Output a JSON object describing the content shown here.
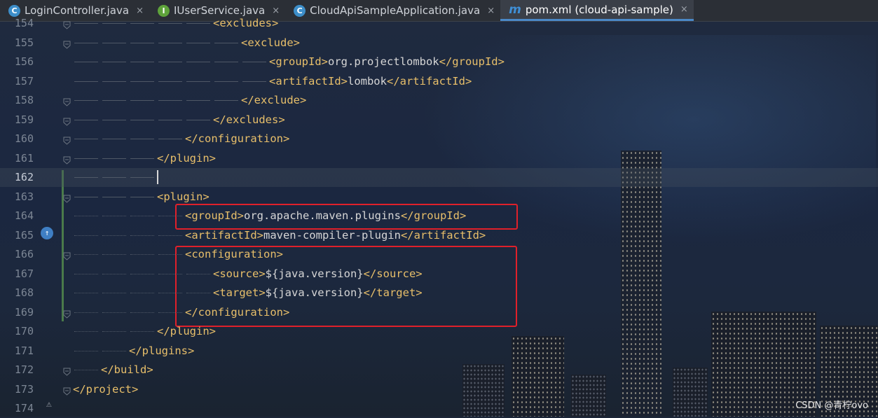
{
  "tabs": [
    {
      "label": "LoginController.java",
      "icon": "class-icon",
      "glyph": "C",
      "active": false
    },
    {
      "label": "IUserService.java",
      "icon": "interface-icon",
      "glyph": "I",
      "active": false
    },
    {
      "label": "CloudApiSampleApplication.java",
      "icon": "application-class-icon",
      "glyph": "C",
      "active": false
    },
    {
      "label": "pom.xml (cloud-api-sample)",
      "icon": "maven-icon",
      "glyph": "m",
      "active": true
    }
  ],
  "tab_close_glyph": "×",
  "lines": [
    {
      "num": "154",
      "indent": 5,
      "parts": [
        {
          "t": "tag",
          "v": "<excludes>"
        }
      ]
    },
    {
      "num": "155",
      "indent": 6,
      "parts": [
        {
          "t": "tag",
          "v": "<exclude>"
        }
      ]
    },
    {
      "num": "156",
      "indent": 7,
      "parts": [
        {
          "t": "tag",
          "v": "<groupId>"
        },
        {
          "t": "txt",
          "v": "org.projectlombok"
        },
        {
          "t": "tag",
          "v": "</groupId>"
        }
      ]
    },
    {
      "num": "157",
      "indent": 7,
      "parts": [
        {
          "t": "tag",
          "v": "<artifactId>"
        },
        {
          "t": "txt",
          "v": "lombok"
        },
        {
          "t": "tag",
          "v": "</artifactId>"
        }
      ]
    },
    {
      "num": "158",
      "indent": 6,
      "parts": [
        {
          "t": "tag",
          "v": "</exclude>"
        }
      ]
    },
    {
      "num": "159",
      "indent": 5,
      "parts": [
        {
          "t": "tag",
          "v": "</excludes>"
        }
      ]
    },
    {
      "num": "160",
      "indent": 4,
      "parts": [
        {
          "t": "tag",
          "v": "</configuration>"
        }
      ]
    },
    {
      "num": "161",
      "indent": 3,
      "parts": [
        {
          "t": "tag",
          "v": "</plugin>"
        }
      ]
    },
    {
      "num": "162",
      "indent": 3,
      "parts": [],
      "current": true
    },
    {
      "num": "163",
      "indent": 3,
      "parts": [
        {
          "t": "tag",
          "v": "<plugin>"
        }
      ]
    },
    {
      "num": "164",
      "indent": 4,
      "parts": [
        {
          "t": "tag",
          "v": "<groupId>"
        },
        {
          "t": "txt",
          "v": "org.apache.maven.plugins"
        },
        {
          "t": "tag",
          "v": "</groupId>"
        }
      ]
    },
    {
      "num": "165",
      "indent": 4,
      "parts": [
        {
          "t": "tag",
          "v": "<artifactId>"
        },
        {
          "t": "txt",
          "v": "maven-compiler-plugin"
        },
        {
          "t": "tag",
          "v": "</artifactId>"
        }
      ]
    },
    {
      "num": "166",
      "indent": 4,
      "parts": [
        {
          "t": "tag",
          "v": "<configuration>"
        }
      ]
    },
    {
      "num": "167",
      "indent": 5,
      "parts": [
        {
          "t": "tag",
          "v": "<source>"
        },
        {
          "t": "txt",
          "v": "${java.version}"
        },
        {
          "t": "tag",
          "v": "</source>"
        }
      ]
    },
    {
      "num": "168",
      "indent": 5,
      "parts": [
        {
          "t": "tag",
          "v": "<target>"
        },
        {
          "t": "txt",
          "v": "${java.version}"
        },
        {
          "t": "tag",
          "v": "</target>"
        }
      ]
    },
    {
      "num": "169",
      "indent": 4,
      "parts": [
        {
          "t": "tag",
          "v": "</configuration>"
        }
      ]
    },
    {
      "num": "170",
      "indent": 3,
      "parts": [
        {
          "t": "tag",
          "v": "</plugin>"
        }
      ]
    },
    {
      "num": "171",
      "indent": 2,
      "parts": [
        {
          "t": "tag",
          "v": "</plugins>"
        }
      ]
    },
    {
      "num": "172",
      "indent": 1,
      "parts": [
        {
          "t": "tag",
          "v": "</build>"
        }
      ]
    },
    {
      "num": "173",
      "indent": 0,
      "parts": [
        {
          "t": "tag",
          "v": "</project>"
        }
      ]
    },
    {
      "num": "174",
      "indent": 0,
      "parts": []
    }
  ],
  "watermark": "CSDN @青柠ovo",
  "colors": {
    "tag": "#e8bf6a",
    "text": "#d6d6d6",
    "highlight_box": "#e0202a",
    "active_tab_underline": "#4a88c7"
  }
}
